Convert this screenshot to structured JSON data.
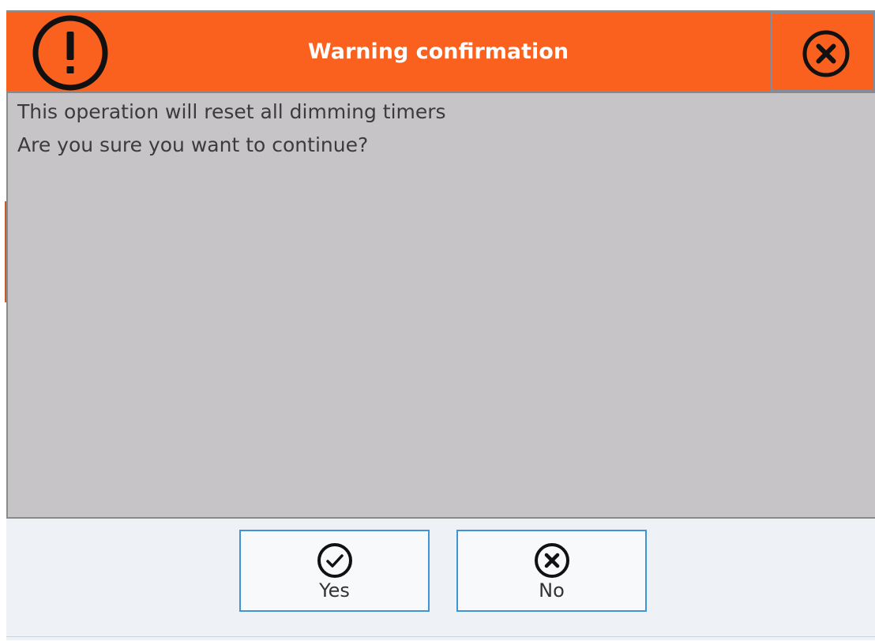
{
  "dialog": {
    "title": "Warning confirmation",
    "icon": "warning-exclamation-icon",
    "accent_color": "#fa601e"
  },
  "message": {
    "line1": "This operation will reset all dimming timers",
    "line2": "Are you sure you want to continue?"
  },
  "buttons": {
    "yes": {
      "label": "Yes",
      "icon": "check-circle-icon"
    },
    "no": {
      "label": "No",
      "icon": "close-circle-icon"
    },
    "close": {
      "icon": "close-circle-icon"
    }
  }
}
